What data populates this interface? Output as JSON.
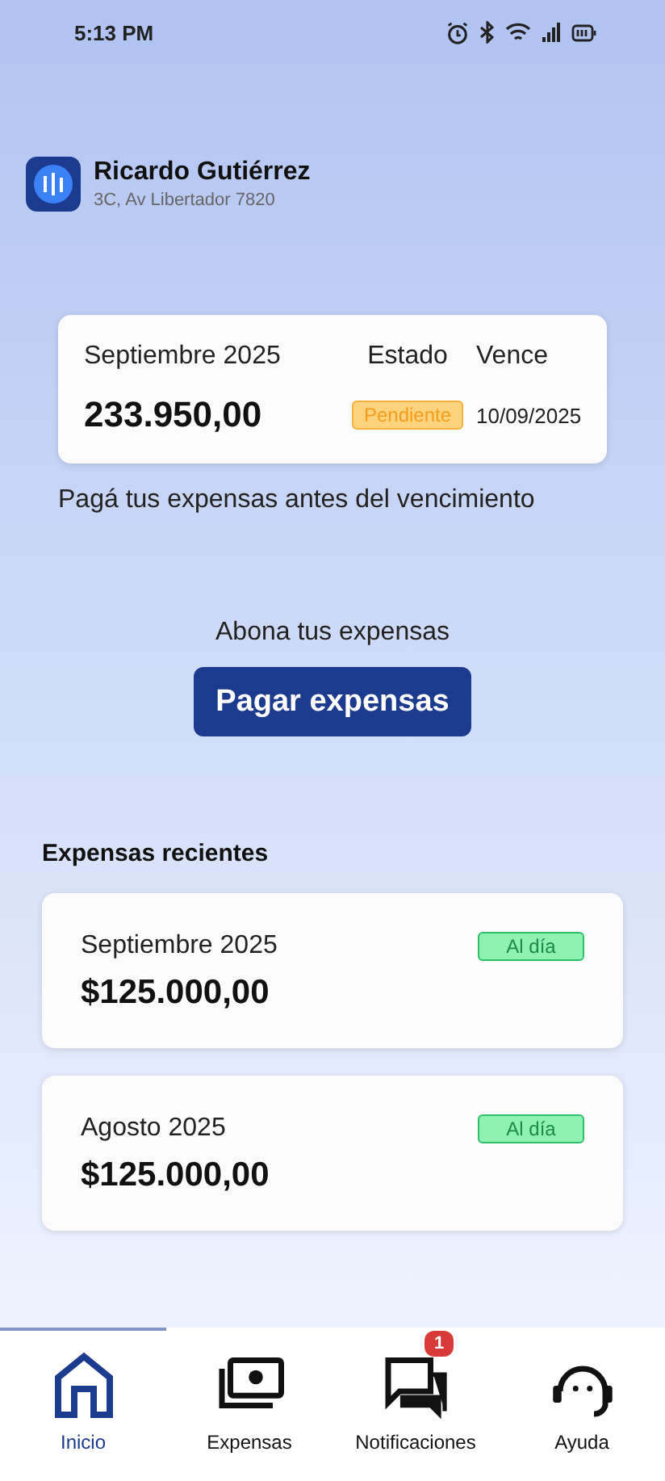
{
  "status_bar": {
    "time": "5:13 PM"
  },
  "user": {
    "name": "Ricardo Gutiérrez",
    "address": "3C, Av Libertador 7820"
  },
  "current": {
    "period": "Septiembre 2025",
    "amount": "233.950,00",
    "status_label": "Estado",
    "status": {
      "text": "Pendiente",
      "kind": "pending"
    },
    "due_label": "Vence",
    "due_date": "10/09/2025"
  },
  "hint": "Pagá tus expensas antes del vencimiento",
  "pay": {
    "prompt": "Abona tus expensas",
    "button": "Pagar expensas"
  },
  "recent": {
    "title": "Expensas recientes",
    "items": [
      {
        "period": "Septiembre 2025",
        "amount": "$125.000,00",
        "status": {
          "text": "Al día",
          "kind": "ok"
        }
      },
      {
        "period": "Agosto 2025",
        "amount": "$125.000,00",
        "status": {
          "text": "Al día",
          "kind": "ok"
        }
      }
    ]
  },
  "nav": [
    {
      "label": "Inicio",
      "kind": "home",
      "selected": true
    },
    {
      "label": "Expensas",
      "kind": "money",
      "selected": false
    },
    {
      "label": "Notificaciones",
      "kind": "chat",
      "selected": false,
      "badge": "1"
    },
    {
      "label": "Ayuda",
      "kind": "support",
      "selected": false
    }
  ]
}
